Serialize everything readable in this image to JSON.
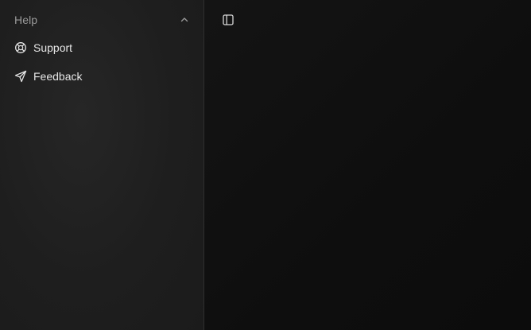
{
  "sidebar": {
    "group": {
      "title": "Help",
      "icon": "chevron-up-icon",
      "items": [
        {
          "label": "Support",
          "icon": "lifebuoy-icon"
        },
        {
          "label": "Feedback",
          "icon": "send-icon"
        }
      ]
    }
  },
  "main": {
    "toggle_icon": "sidebar-toggle-icon"
  },
  "colors": {
    "sidebar_bg": "#1e1e1e",
    "main_bg": "#0e0e0e",
    "text": "#e6e6e6",
    "muted": "#9a9a9a"
  }
}
